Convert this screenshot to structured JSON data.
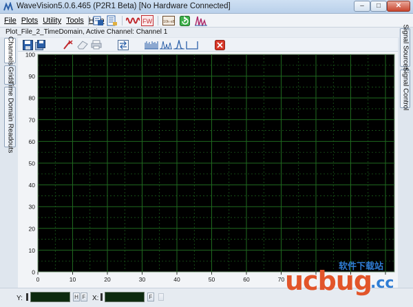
{
  "window": {
    "title": "WaveVision5.0.6.465 (P2R1 Beta)  [No Hardware Connected]",
    "min_glyph": "–",
    "max_glyph": "□",
    "close_glyph": "✕"
  },
  "menu": [
    "File",
    "Plots",
    "Utility",
    "Tools",
    "Help"
  ],
  "menu_tools": [
    {
      "name": "open-plot-icon",
      "color": "#2a5fa8"
    },
    {
      "name": "plot-list-icon",
      "color": "#2a5fa8"
    },
    {
      "name": "waveform-red-icon",
      "color": "#c0282c"
    },
    {
      "name": "fw-icon",
      "color": "#c0282c",
      "label": "FW"
    },
    {
      "name": "data-file-icon",
      "color": "#6a4a2a",
      "label": "10k-s8"
    },
    {
      "name": "refresh-green-icon",
      "color": "#2e9a3b"
    },
    {
      "name": "spectrum-icon",
      "color": "#b02a6a"
    }
  ],
  "plot": {
    "title": "Plot_File_2_TimeDomain,  Active Channel: Channel 1",
    "x_ticks": [
      "0",
      "10",
      "20",
      "30",
      "40",
      "50",
      "60",
      "70"
    ],
    "y_ticks": [
      "100",
      "90",
      "80",
      "70",
      "60",
      "50",
      "40",
      "30",
      "20",
      "10",
      "0"
    ],
    "grid_color": "#1f6a1f",
    "bg_color": "#000000",
    "axis_color": "#7da07d"
  },
  "left_tabs": [
    "Channels",
    "Grids",
    "Time Domain Readouts"
  ],
  "right_tabs": [
    "Signal Sources",
    "Signal Control"
  ],
  "plot_tools": [
    "save-plot-icon",
    "save-all-icon",
    "cursor-remove-icon",
    "eraser-icon",
    "print-icon",
    "export-icon",
    "waveform-view-icon",
    "spectrum-view-icon",
    "histogram-view-icon",
    "fft-view-icon",
    "close-plot-icon"
  ],
  "readouts": {
    "y_label": "Y:",
    "x_label": "X:",
    "h_glyph": "H",
    "f_glyph": "F"
  },
  "watermark": {
    "logo": "ucbug",
    "suffix": ".cc",
    "tagline": "软件下载站"
  }
}
